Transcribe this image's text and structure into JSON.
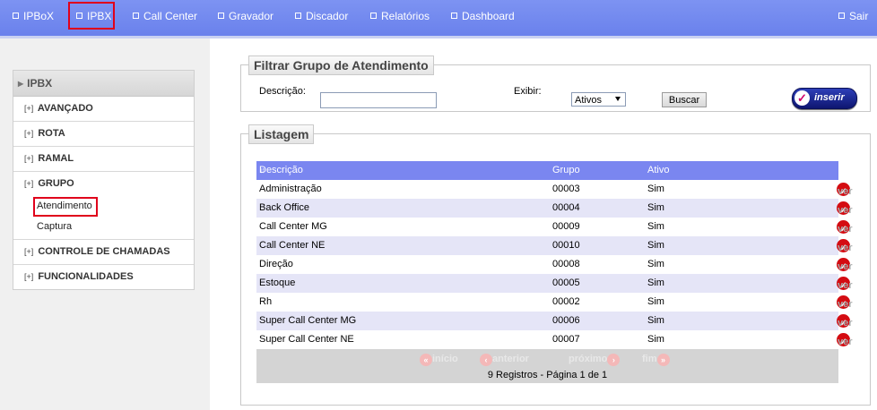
{
  "nav": {
    "items": [
      "IPBoX",
      "IPBX",
      "Call Center",
      "Gravador",
      "Discador",
      "Relatórios",
      "Dashboard"
    ],
    "sair": "Sair"
  },
  "menu": {
    "title": "IPBX",
    "plus": "[+]",
    "avancado": "AVANÇADO",
    "rota": "ROTA",
    "ramal": "RAMAL",
    "grupo": "GRUPO",
    "sub": [
      "Atendimento",
      "Captura"
    ],
    "controle": "CONTROLE DE CHAMADAS",
    "funcionalidades": "FUNCIONALIDADES"
  },
  "filter": {
    "legend": "Filtrar Grupo de Atendimento",
    "descricao_label": "Descrição:",
    "descricao_value": "",
    "exibir_label": "Exibir:",
    "exibir_value": "Ativos",
    "buscar": "Buscar",
    "inserir": "inserir"
  },
  "listagem": {
    "legend": "Listagem",
    "columns": [
      "Descrição",
      "Grupo",
      "Ativo"
    ],
    "ver": "ver",
    "rows": [
      {
        "descricao": "Administração",
        "grupo": "00003",
        "ativo": "Sim"
      },
      {
        "descricao": "Back Office",
        "grupo": "00004",
        "ativo": "Sim"
      },
      {
        "descricao": "Call Center MG",
        "grupo": "00009",
        "ativo": "Sim"
      },
      {
        "descricao": "Call Center NE",
        "grupo": "00010",
        "ativo": "Sim"
      },
      {
        "descricao": "Direção",
        "grupo": "00008",
        "ativo": "Sim"
      },
      {
        "descricao": "Estoque",
        "grupo": "00005",
        "ativo": "Sim"
      },
      {
        "descricao": "Rh",
        "grupo": "00002",
        "ativo": "Sim"
      },
      {
        "descricao": "Super Call Center MG",
        "grupo": "00006",
        "ativo": "Sim"
      },
      {
        "descricao": "Super Call Center NE",
        "grupo": "00007",
        "ativo": "Sim"
      }
    ],
    "pager": {
      "inicio": "início",
      "anterior": "anterior",
      "proximo": "próximo",
      "fim": "fim",
      "info": "9 Registros - Página 1 de 1"
    }
  },
  "colors": {
    "nav_bg": "#7289ee",
    "header_bg": "#7a86f0",
    "row_alt": "#e5e5f7",
    "highlight": "#e0001b",
    "ver_icon": "#d40c12"
  }
}
